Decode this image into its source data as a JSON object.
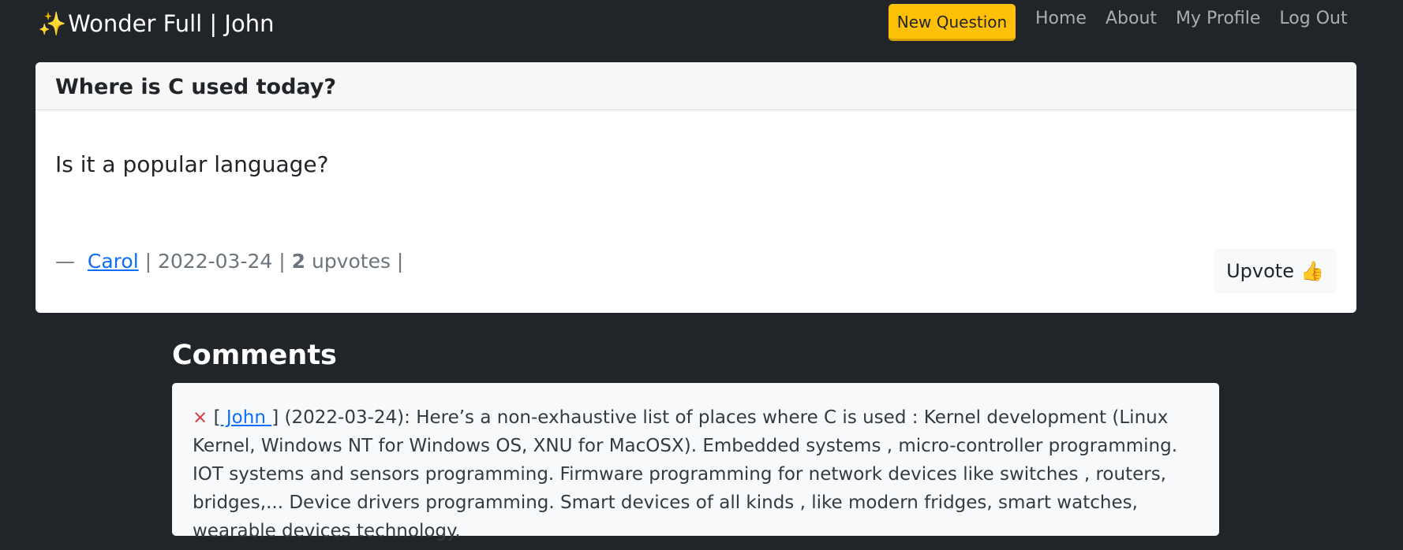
{
  "navbar": {
    "brand_icon": "✨",
    "brand_text": "Wonder Full | John",
    "new_question_label": "New Question",
    "links": [
      "Home",
      "About",
      "My Profile",
      "Log Out"
    ]
  },
  "question": {
    "title": "Where is C used today?",
    "body": "Is it a popular language?",
    "dash": "—",
    "author": "Carol",
    "date": "2022-03-24",
    "upvote_count": "2",
    "upvotes_word": "upvotes",
    "upvote_button_label": "Upvote",
    "upvote_button_icon": "👍"
  },
  "comments": {
    "heading": "Comments",
    "items": [
      {
        "delete_icon": "×",
        "author": " John ",
        "date": "(2022-03-24):",
        "text": "Here’s a non-exhaustive list of places where C is used : Kernel development (Linux Kernel, Windows NT for Windows OS, XNU for MacOSX). Embedded systems , micro-controller programming. IOT systems and sensors programming. Firmware programming for network devices like switches , routers, bridges,... Device drivers programming. Smart devices of all kinds , like modern fridges, smart watches, wearable devices technology."
      }
    ]
  },
  "colors": {
    "background": "#212529",
    "accent_warning": "#ffc107",
    "link": "#0d6efd",
    "delete": "#dc3545"
  }
}
